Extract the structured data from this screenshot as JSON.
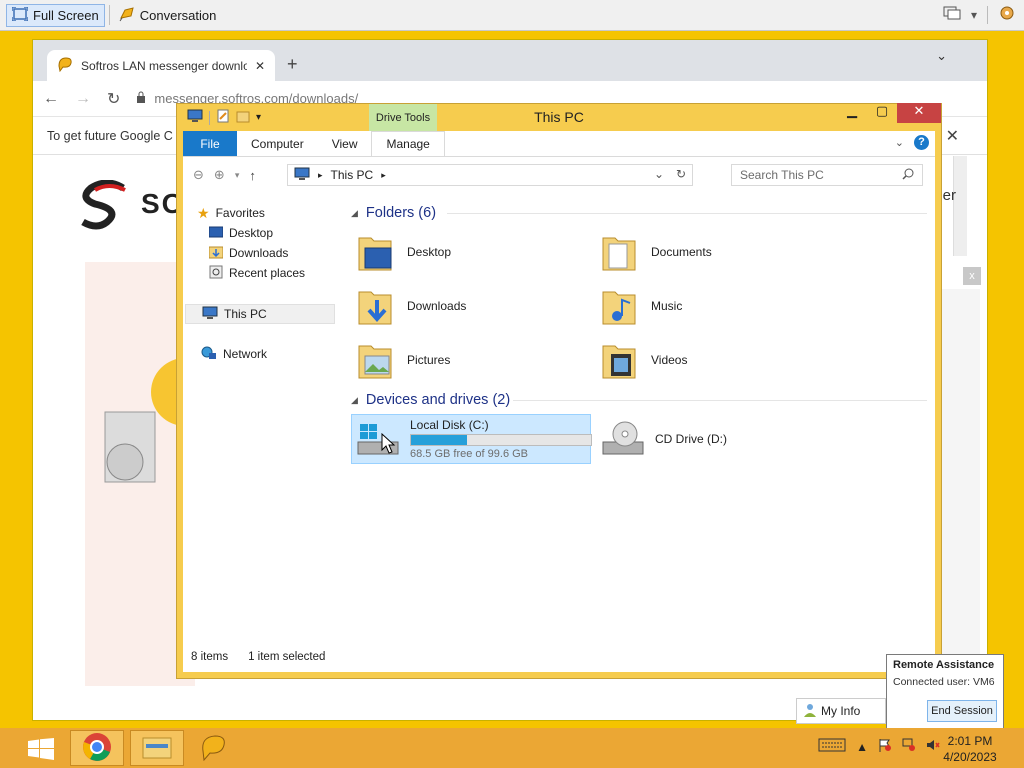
{
  "viewer": {
    "full_screen_label": "Full Screen",
    "conversation_label": "Conversation"
  },
  "chrome": {
    "tab_title": "Softros LAN messenger downloa",
    "url_host": "messenger.softros.com",
    "url_path": "/downloads/",
    "infobar_text": "To get future Google C",
    "logo_text": "SO",
    "fragment_text": "nger",
    "fragment_close": "x"
  },
  "explorer": {
    "title": "This PC",
    "contextual_tab": "Drive Tools",
    "ribbon_tabs": [
      "File",
      "Computer",
      "View",
      "Manage"
    ],
    "address_crumb": "This PC",
    "search_placeholder": "Search This PC",
    "nav": {
      "favorites": "Favorites",
      "desktop": "Desktop",
      "downloads": "Downloads",
      "recent": "Recent places",
      "this_pc": "This PC",
      "network": "Network"
    },
    "folders_header": "Folders (6)",
    "folders": [
      "Desktop",
      "Documents",
      "Downloads",
      "Music",
      "Pictures",
      "Videos"
    ],
    "drives_header": "Devices and drives (2)",
    "drives": [
      {
        "name": "Local Disk (C:)",
        "free_text": "68.5 GB free of 99.6 GB",
        "used_fraction": 0.312
      },
      {
        "name": "CD Drive (D:)"
      }
    ],
    "status_items": "8 items",
    "status_selected": "1 item selected"
  },
  "remote_assistance": {
    "title": "Remote Assistance",
    "connected_user": "Connected user: VM6",
    "end_session": "End Session",
    "my_info": "My Info"
  },
  "taskbar": {
    "time": "2:01 PM",
    "date": "4/20/2023"
  },
  "colors": {
    "desktop_bg": "#f5c400",
    "explorer_frame": "#f6cc4e",
    "taskbar": "#eba734",
    "selection": "#cce8ff",
    "drive_bar": "#26a0da",
    "close_red": "#c74343"
  }
}
